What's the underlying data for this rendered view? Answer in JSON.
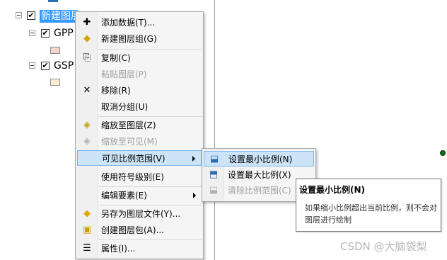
{
  "toc": {
    "group": {
      "label": "新建图层组",
      "checked": "✔"
    },
    "layers": [
      {
        "label": "GPP",
        "checked": "✔",
        "swatch_color": "#f0d6cc"
      },
      {
        "label": "GSP",
        "checked": "✔",
        "swatch_color": "#fbeed8"
      }
    ]
  },
  "context_menu": {
    "items": [
      {
        "label": "添加数据(T)...",
        "icon": "add-data-icon",
        "enabled": true
      },
      {
        "label": "新建图层组(G)",
        "icon": "new-group-layer-icon",
        "enabled": true
      },
      {
        "label": "复制(C)",
        "icon": "copy-icon",
        "enabled": true
      },
      {
        "label": "粘贴图层(P)",
        "icon": "paste-icon",
        "enabled": false
      },
      {
        "label": "移除(R)",
        "icon": "remove-icon",
        "enabled": true
      },
      {
        "label": "取消分组(U)",
        "icon": "",
        "enabled": true
      },
      {
        "label": "缩放至图层(Z)",
        "icon": "zoom-to-layer-icon",
        "enabled": true
      },
      {
        "label": "缩放至可见(M)",
        "icon": "zoom-to-visible-icon",
        "enabled": false
      },
      {
        "label": "可见比例范围(V)",
        "icon": "",
        "enabled": true,
        "highlighted": true,
        "submenu": true
      },
      {
        "label": "使用符号级别(E)",
        "icon": "",
        "enabled": true
      },
      {
        "label": "编辑要素(E)",
        "icon": "",
        "enabled": true,
        "submenu": true
      },
      {
        "label": "另存为图层文件(Y)...",
        "icon": "save-layer-file-icon",
        "enabled": true
      },
      {
        "label": "创建图层包(A)...",
        "icon": "layer-package-icon",
        "enabled": true
      },
      {
        "label": "属性(I)...",
        "icon": "properties-icon",
        "enabled": true
      }
    ]
  },
  "submenu": {
    "items": [
      {
        "label": "设置最小比例(N)",
        "icon": "set-min-scale-icon",
        "enabled": true,
        "highlighted": true
      },
      {
        "label": "设置最大比例(X)",
        "icon": "set-max-scale-icon",
        "enabled": true
      },
      {
        "label": "清除比例范围(C)",
        "icon": "clear-scale-range-icon",
        "enabled": false
      }
    ]
  },
  "tooltip": {
    "title": "设置最小比例(N)",
    "body": "如果缩小比例超出当前比例，则不会对图层进行绘制"
  },
  "watermark": "CSDN @大脑袋梨"
}
